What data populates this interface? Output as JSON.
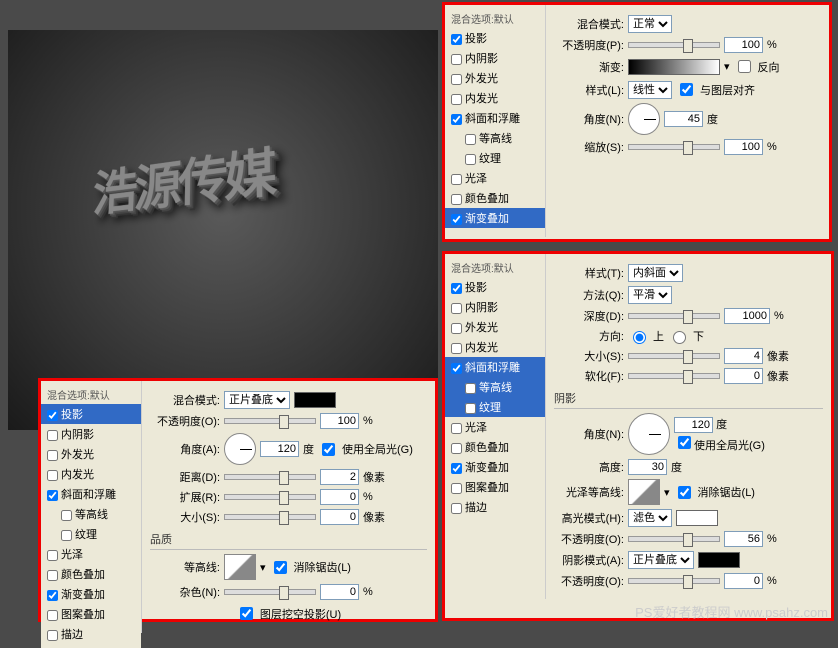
{
  "preview_text": "浩源传媒",
  "styles_list": {
    "header": "混合选项:默认",
    "drop_shadow": "投影",
    "inner_shadow": "内阴影",
    "outer_glow": "外发光",
    "inner_glow": "内发光",
    "bevel": "斜面和浮雕",
    "contour": "等高线",
    "texture": "纹理",
    "satin": "光泽",
    "color_overlay": "颜色叠加",
    "gradient_overlay": "渐变叠加",
    "pattern_overlay": "图案叠加",
    "stroke": "描边"
  },
  "panel1": {
    "blend_mode_lbl": "混合模式:",
    "blend_mode_val": "正常",
    "opacity_lbl": "不透明度(P):",
    "opacity_val": "100",
    "pct": "%",
    "gradient_lbl": "渐变:",
    "reverse": "反向",
    "style_lbl": "样式(L):",
    "style_val": "线性",
    "align": "与图层对齐",
    "angle_lbl": "角度(N):",
    "angle_val": "45",
    "deg": "度",
    "scale_lbl": "缩放(S):",
    "scale_val": "100"
  },
  "panel2": {
    "blend_mode_lbl": "混合模式:",
    "blend_mode_val": "正片叠底",
    "opacity_lbl": "不透明度(O):",
    "opacity_val": "100",
    "pct": "%",
    "angle_lbl": "角度(A):",
    "angle_val": "120",
    "deg": "度",
    "global": "使用全局光(G)",
    "distance_lbl": "距离(D):",
    "distance_val": "2",
    "px": "像素",
    "spread_lbl": "扩展(R):",
    "spread_val": "0",
    "size_lbl": "大小(S):",
    "size_val": "0",
    "quality": "品质",
    "contour_lbl": "等高线:",
    "anti_alias": "消除锯齿(L)",
    "noise_lbl": "杂色(N):",
    "noise_val": "0",
    "knockout": "图层挖空投影(U)"
  },
  "panel3": {
    "style_lbl": "样式(T):",
    "style_val": "内斜面",
    "method_lbl": "方法(Q):",
    "method_val": "平滑",
    "depth_lbl": "深度(D):",
    "depth_val": "1000",
    "pct": "%",
    "direction_lbl": "方向:",
    "dir_up": "上",
    "dir_down": "下",
    "size_lbl": "大小(S):",
    "size_val": "4",
    "px": "像素",
    "soften_lbl": "软化(F):",
    "soften_val": "0",
    "shading": "阴影",
    "angle_lbl": "角度(N):",
    "angle_val": "120",
    "deg": "度",
    "global": "使用全局光(G)",
    "altitude_lbl": "高度:",
    "altitude_val": "30",
    "gloss_lbl": "光泽等高线:",
    "anti_alias": "消除锯齿(L)",
    "highlight_lbl": "高光模式(H):",
    "highlight_val": "滤色",
    "opacity_lbl": "不透明度(O):",
    "highlight_opacity": "56",
    "shadow_mode_lbl": "阴影模式(A):",
    "shadow_mode_val": "正片叠底",
    "shadow_opacity": "0"
  },
  "watermark": "PS爱好者教程网 www.psahz.com"
}
